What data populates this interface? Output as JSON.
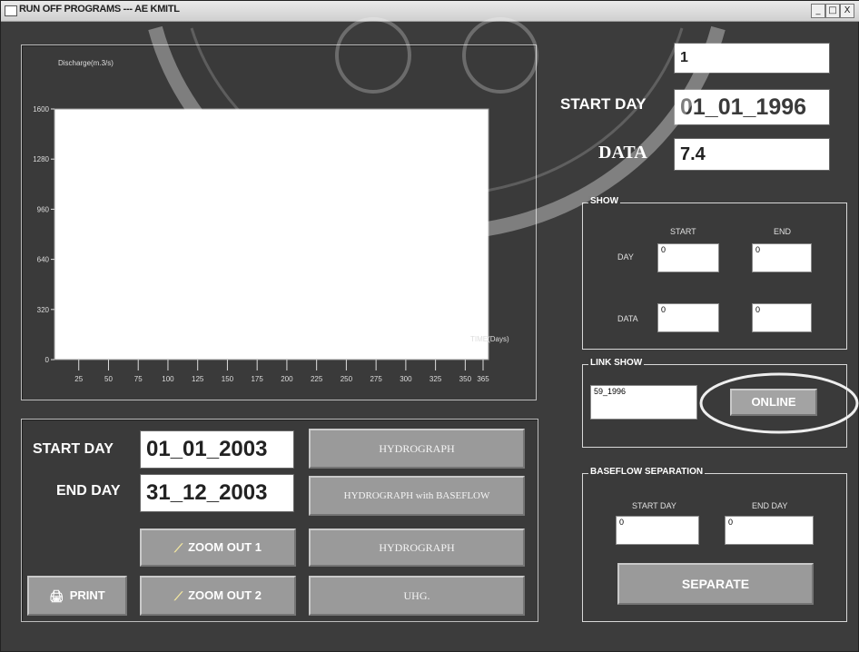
{
  "window": {
    "title": "RUN OFF PROGRAMS --- AE KMITL",
    "controls": [
      "_",
      "□",
      "X"
    ]
  },
  "top_right": {
    "record_value": "1",
    "start_day_label": "START DAY",
    "start_day_value": "01_01_1996",
    "data_label": "DATA",
    "data_value": "7.4"
  },
  "show_group": {
    "title": "SHOW",
    "start_header": "START",
    "end_header": "END",
    "day_label": "DAY",
    "data_label": "DATA",
    "day_start": "0",
    "day_end": "0",
    "data_start": "0",
    "data_end": "0"
  },
  "link_show": {
    "title": "LINK SHOW",
    "value": "59_1996",
    "online_button": "ONLINE"
  },
  "baseflow": {
    "title": "BASEFLOW SEPARATION",
    "start_day_label": "START DAY",
    "end_day_label": "END DAY",
    "start_value": "0",
    "end_value": "0",
    "separate_button": "SEPARATE"
  },
  "controls": {
    "start_day_label": "START DAY",
    "start_day_value": "01_01_2003",
    "end_day_label": "END DAY",
    "end_day_value": "31_12_2003",
    "hydrograph_button": "HYDROGRAPH",
    "hydrograph_baseflow_button": "HYDROGRAPH with BASEFLOW",
    "zoom_out_1_button": "ZOOM OUT 1",
    "hydrograph2_button": "HYDROGRAPH",
    "print_button": "PRINT",
    "zoom_out_2_button": "ZOOM OUT 2",
    "uhg_button": "UHG."
  },
  "chart_data": {
    "type": "line",
    "ylabel": "Discharge(m.3/s)",
    "xlabel": "TIME(Days)",
    "y_ticks": [
      "0",
      "320",
      "640",
      "960",
      "1280",
      "1600"
    ],
    "x_ticks": [
      "25",
      "50",
      "75",
      "100",
      "125",
      "150",
      "175",
      "200",
      "225",
      "250",
      "275",
      "300",
      "325",
      "350",
      "365"
    ],
    "ylim": [
      0,
      1600
    ],
    "xlim": [
      0,
      365
    ],
    "series": []
  },
  "colors": {
    "background": "#3c3c3c",
    "plot_area": "#ffffff",
    "button": "#9a9a9a"
  }
}
